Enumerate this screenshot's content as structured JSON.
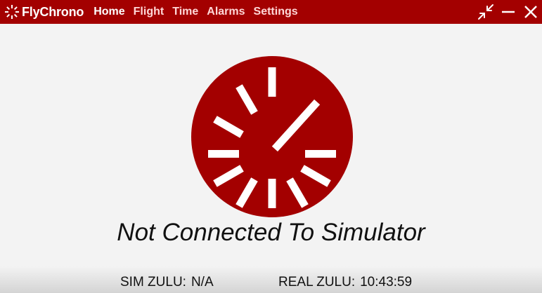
{
  "app": {
    "name": "FlyChrono",
    "brand_color": "#a30000",
    "logo_icon": "sunburst-icon"
  },
  "nav": {
    "items": [
      {
        "label": "Home",
        "active": true
      },
      {
        "label": "Flight",
        "active": false
      },
      {
        "label": "Time",
        "active": false
      },
      {
        "label": "Alarms",
        "active": false
      },
      {
        "label": "Settings",
        "active": false
      }
    ]
  },
  "window_controls": {
    "icons": [
      "compress-icon",
      "minimize-icon",
      "close-icon"
    ]
  },
  "main": {
    "logo_icon": "clock-icon",
    "status_message": "Not Connected To Simulator"
  },
  "status_bar": {
    "sim_zulu_label": "SIM ZULU:",
    "sim_zulu_value": "N/A",
    "real_zulu_label": "REAL ZULU:",
    "real_zulu_value": "10:43:59"
  }
}
